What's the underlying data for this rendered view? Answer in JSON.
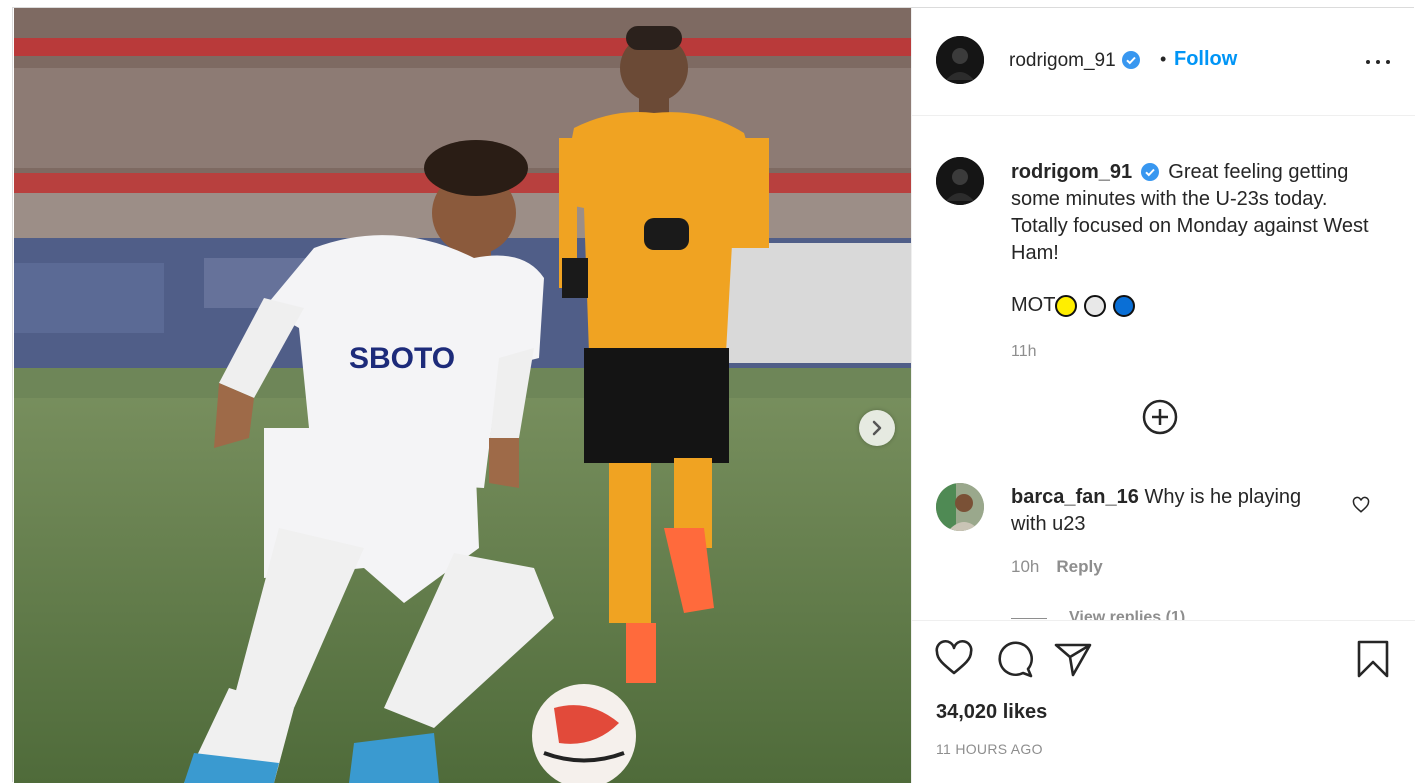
{
  "post": {
    "image_alt": "Footballer in white kit dribbling a ball with an opponent in orange behind",
    "next_icon": "chevron-right-icon"
  },
  "header": {
    "username": "rodrigom_91",
    "separator": "•",
    "follow_label": "Follow",
    "verified_color": "#3897f0"
  },
  "caption": {
    "username": "rodrigom_91",
    "text": "Great feeling getting some minutes with the U-23s today. Totally focused on Monday against West Ham!",
    "mot_text": "MOT",
    "circles": [
      "#ffee00",
      "#e8e8e8",
      "#0a6fd6"
    ],
    "time": "11h"
  },
  "comment": {
    "username": "barca_fan_16",
    "text": "Why is he playing with u23",
    "time": "10h",
    "reply_label": "Reply",
    "view_replies": "View replies (1)"
  },
  "footer": {
    "likes": "34,020 likes",
    "time_ago": "11 HOURS AGO"
  }
}
